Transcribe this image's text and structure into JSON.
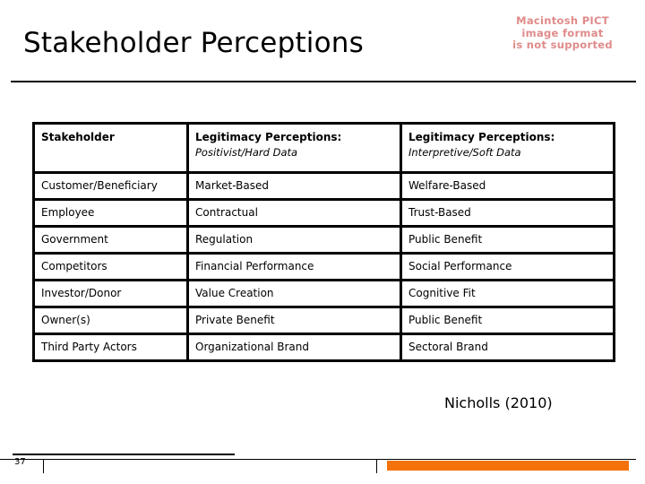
{
  "slide": {
    "title": "Stakeholder Perceptions",
    "citation": "Nicholls (2010)",
    "number": "37"
  },
  "pict_placeholder": {
    "line1": "Macintosh PICT",
    "line2": "image format",
    "line3": "is not supported",
    "color": "#e08a8a"
  },
  "table": {
    "headers": [
      {
        "main": "Stakeholder",
        "sub": ""
      },
      {
        "main": "Legitimacy Perceptions:",
        "sub": "Positivist/Hard Data"
      },
      {
        "main": "Legitimacy Perceptions:",
        "sub": "Interpretive/Soft Data"
      }
    ],
    "rows": [
      {
        "stakeholder": "Customer/Beneficiary",
        "positivist": "Market-Based",
        "interpretive": "Welfare-Based"
      },
      {
        "stakeholder": "Employee",
        "positivist": "Contractual",
        "interpretive": "Trust-Based"
      },
      {
        "stakeholder": "Government",
        "positivist": "Regulation",
        "interpretive": "Public Benefit"
      },
      {
        "stakeholder": "Competitors",
        "positivist": "Financial Performance",
        "interpretive": "Social Performance"
      },
      {
        "stakeholder": "Investor/Donor",
        "positivist": "Value Creation",
        "interpretive": "Cognitive Fit"
      },
      {
        "stakeholder": "Owner(s)",
        "positivist": "Private Benefit",
        "interpretive": "Public Benefit"
      },
      {
        "stakeholder": "Third Party Actors",
        "positivist": "Organizational Brand",
        "interpretive": "Sectoral Brand"
      }
    ]
  },
  "footer": {
    "accent_color": "#f4720b"
  }
}
